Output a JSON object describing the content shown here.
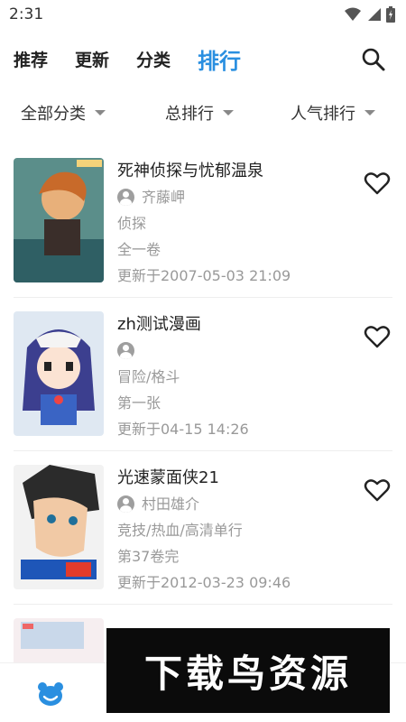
{
  "status_bar": {
    "time": "2:31"
  },
  "nav": {
    "tabs": [
      {
        "label": "推荐",
        "active": false
      },
      {
        "label": "更新",
        "active": false
      },
      {
        "label": "分类",
        "active": false
      },
      {
        "label": "排行",
        "active": true
      }
    ],
    "search_icon": "search-icon",
    "active_color": "#2a8fe0"
  },
  "filters": [
    {
      "label": "全部分类"
    },
    {
      "label": "总排行"
    },
    {
      "label": "人气排行"
    }
  ],
  "comics": [
    {
      "title": "死神侦探与忧郁温泉",
      "author": "齐藤岬",
      "genre": "侦探",
      "status": "全一卷",
      "updated": "更新于2007-05-03 21:09"
    },
    {
      "title": "zh测试漫画",
      "author": "",
      "genre": "冒险/格斗",
      "status": "第一张",
      "updated": "更新于04-15 14:26"
    },
    {
      "title": "光速蒙面侠21",
      "author": "村田雄介",
      "genre": "竞技/热血/高清单行",
      "status": "第37卷完",
      "updated": "更新于2012-03-23 09:46"
    }
  ],
  "bottom_bar": {
    "icon": "bear-icon",
    "accent": "#2a8fe0"
  },
  "watermark": {
    "text": "下载鸟资源"
  }
}
